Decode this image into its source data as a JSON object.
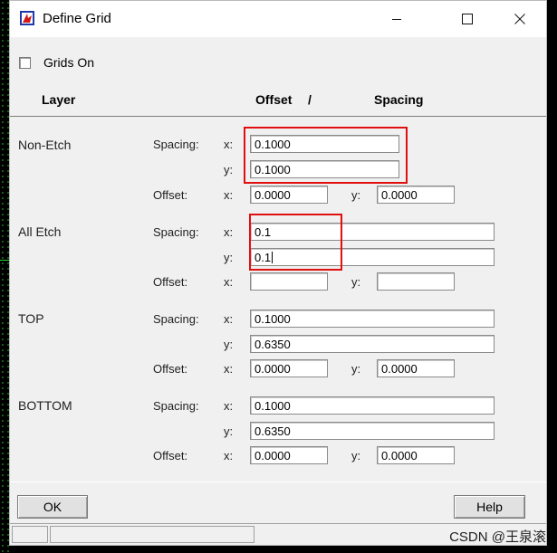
{
  "window": {
    "title": "Define Grid"
  },
  "grids_on": {
    "label": "Grids On",
    "checked": false
  },
  "headers": {
    "layer": "Layer",
    "offset": "Offset",
    "slash": "/",
    "spacing": "Spacing"
  },
  "labels": {
    "spacing": "Spacing:",
    "offset": "Offset:",
    "x": "x:",
    "y": "y:"
  },
  "layers": [
    {
      "name": "Non-Etch",
      "spacing_x": "0.1000",
      "spacing_y": "0.1000",
      "offset_x": "0.0000",
      "offset_y": "0.0000"
    },
    {
      "name": "All Etch",
      "spacing_x": "0.1",
      "spacing_y": "0.1",
      "offset_x": "",
      "offset_y": ""
    },
    {
      "name": "TOP",
      "spacing_x": "0.1000",
      "spacing_y": "0.6350",
      "offset_x": "0.0000",
      "offset_y": "0.0000"
    },
    {
      "name": "BOTTOM",
      "spacing_x": "0.1000",
      "spacing_y": "0.6350",
      "offset_x": "0.0000",
      "offset_y": "0.0000"
    }
  ],
  "buttons": {
    "ok": "OK",
    "help": "Help"
  },
  "watermark": "CSDN @王泉滚",
  "colors": {
    "highlight": "#e01010",
    "window_bg": "#f0f0f0"
  }
}
